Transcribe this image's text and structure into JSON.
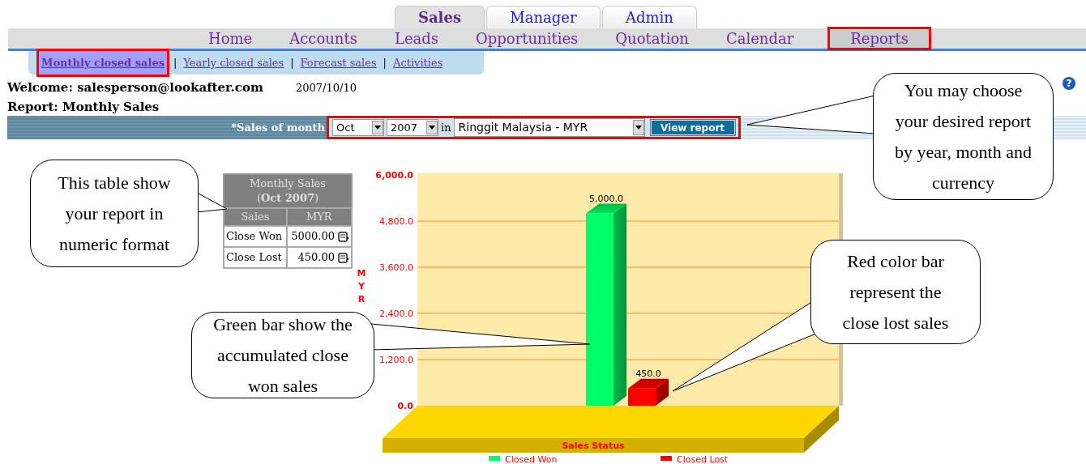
{
  "top_tabs": [
    {
      "label": "Sales",
      "selected": true
    },
    {
      "label": "Manager",
      "selected": false
    },
    {
      "label": "Admin",
      "selected": false
    }
  ],
  "nav": [
    {
      "label": "Home",
      "selected": false
    },
    {
      "label": "Accounts",
      "selected": false
    },
    {
      "label": "Leads",
      "selected": false
    },
    {
      "label": "Opportunities",
      "selected": false
    },
    {
      "label": "Quotation",
      "selected": false
    },
    {
      "label": "Calendar",
      "selected": false
    },
    {
      "label": "Reports",
      "selected": true
    }
  ],
  "subnav": {
    "items": [
      {
        "label": "Monthly closed sales",
        "selected": true
      },
      {
        "label": "Yearly closed sales",
        "selected": false
      },
      {
        "label": "Forecast sales",
        "selected": false
      },
      {
        "label": "Activities",
        "selected": false
      }
    ],
    "separators": [
      "|",
      "|",
      "|"
    ]
  },
  "welcome": {
    "text": "Welcome: salesperson@lookafter.com",
    "date": "2007/10/10"
  },
  "help": "?",
  "report_title": "Report: Monthly Sales",
  "filter": {
    "label": "*Sales of month",
    "month": "Oct",
    "year": "2007",
    "connector": "in",
    "currency": "Ringgit Malaysia - MYR",
    "button": "View report"
  },
  "summary_table": {
    "title": "Monthly Sales",
    "period": "(**Oct 2007**)",
    "columns": [
      "Sales",
      "MYR"
    ],
    "rows": [
      {
        "name": "Close Won",
        "amount": "5000.00"
      },
      {
        "name": "Close Lost",
        "amount": "450.00"
      }
    ]
  },
  "chart": {
    "chart_data": {
      "type": "bar",
      "xlabel": "Sales Status",
      "ylabel": "MYR",
      "categories": [
        "Closed Won",
        "Closed Lost"
      ],
      "values": [
        5000,
        450
      ],
      "colors": [
        "#00ff66",
        "#ff0000"
      ],
      "grid": true,
      "ylim": [
        0,
        6000
      ],
      "yticks": [
        {
          "value": 0,
          "label": "0.0"
        },
        {
          "value": 1200,
          "label": "1,200.0"
        },
        {
          "value": 2400,
          "label": "2,400.0"
        },
        {
          "value": 3600,
          "label": "3,600.0"
        },
        {
          "value": 4800,
          "label": "4,800.0"
        },
        {
          "value": 6000,
          "label": "6,000.0"
        }
      ],
      "value_labels": [
        "5,000.0",
        "450.0"
      ]
    }
  },
  "callouts": [
    {
      "text": "This table show your report in numeric format"
    },
    {
      "text": "You may choose your desired report by year, month and currency"
    },
    {
      "text": "Green bar show the accumulated close won sales"
    },
    {
      "text": "Red color bar represent the close lost sales"
    }
  ]
}
